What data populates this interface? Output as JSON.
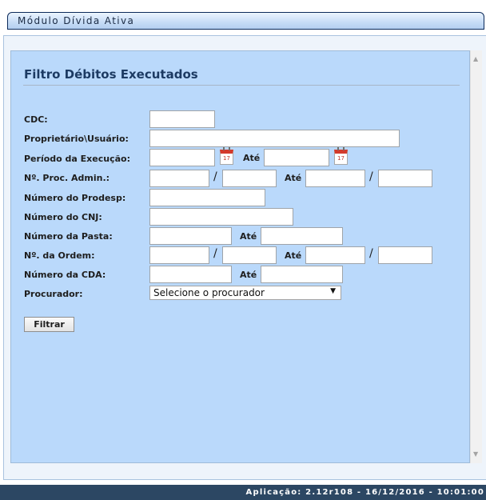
{
  "header": {
    "title": "Módulo Dívida Ativa"
  },
  "filter": {
    "title": "Filtro Débitos Executados",
    "labels": {
      "cdc": "CDC:",
      "owner": "Proprietário\\Usuário:",
      "period": "Período da Execução:",
      "proc_admin": "Nº. Proc. Admin.:",
      "prodesp": "Número do Prodesp:",
      "cnj": "Número do CNJ:",
      "pasta": "Número da Pasta:",
      "ordem": "Nº. da Ordem:",
      "cda": "Número da CDA:",
      "procurador": "Procurador:"
    },
    "ate": "Até",
    "slash": "/",
    "calendar_icon": "calendar-icon",
    "calendar_text": "17",
    "procurador_select": "Selecione o procurador",
    "filter_button": "Filtrar"
  },
  "footer": {
    "text": "Aplicação: 2.12r108 - 16/12/2016 - 10:01:00"
  }
}
